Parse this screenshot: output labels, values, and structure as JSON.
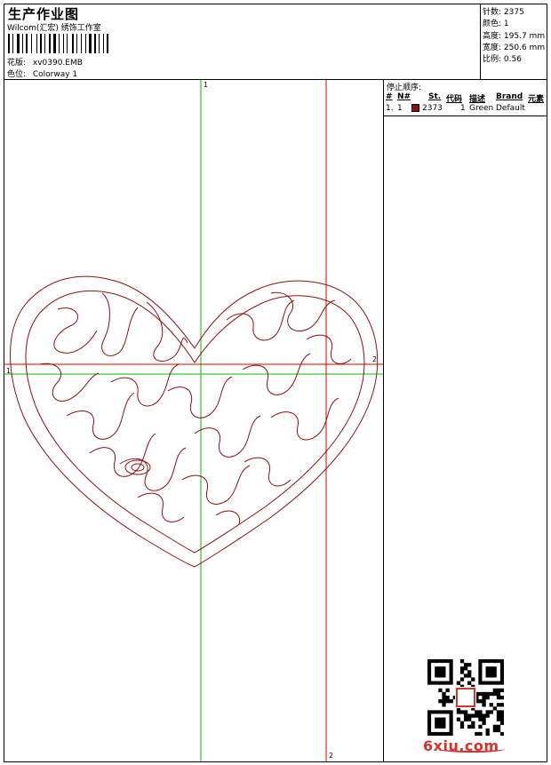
{
  "header": {
    "title": "生产作业图",
    "company": "Wilcom(汇宏) 绣饰工作室",
    "design_label": "花版:",
    "design_value": "xv0390.EMB",
    "colorway_label": "色位:",
    "colorway_value": "Colorway 1"
  },
  "stats": [
    {
      "label": "针数:",
      "value": "2375"
    },
    {
      "label": "颜色:",
      "value": "1"
    },
    {
      "label": "高度:",
      "value": "195.7 mm"
    },
    {
      "label": "宽度:",
      "value": "250.6 mm"
    },
    {
      "label": "比例:",
      "value": "0.56"
    }
  ],
  "axes": {
    "green_top": "1",
    "green_left": "1",
    "red_bottom": "2",
    "red_right": "2"
  },
  "stop_sequence": {
    "title": "停止顺序:",
    "columns": [
      "#",
      "N#",
      "St.",
      "代码",
      "描述",
      "Brand",
      "元素"
    ],
    "rows": [
      {
        "index": "1.",
        "needle": "1",
        "stitches": "2373",
        "code": "1",
        "description": "Green",
        "brand": "Default",
        "swatch_color": "#8b1010"
      }
    ]
  },
  "watermark": {
    "text": "6xiu.com"
  },
  "colors": {
    "thread": "#8b1010",
    "green_axis": "#00c000",
    "red_axis": "#e00000",
    "brand": "#d2332b"
  }
}
